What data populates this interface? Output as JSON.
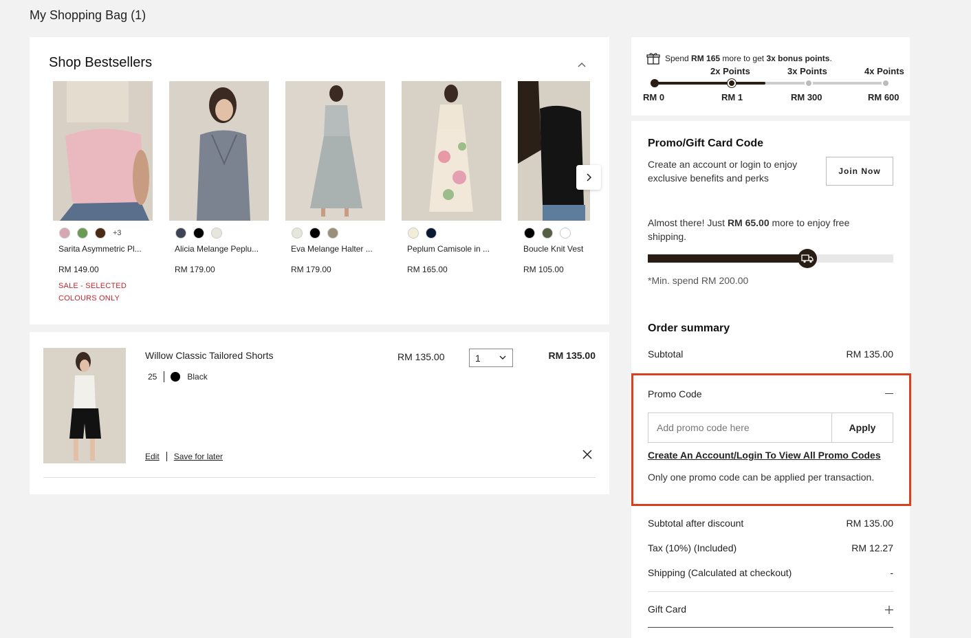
{
  "page": {
    "title": "My Shopping Bag (1)"
  },
  "bestsellers": {
    "title": "Shop Bestsellers",
    "products": [
      {
        "name": "Sarita Asymmetric Pl...",
        "price": "RM 149.00",
        "swatches": [
          "#d6a8b2",
          "#6a9a55",
          "#4a2a12"
        ],
        "more": "+3",
        "sale": [
          "SALE - SELECTED",
          "COLOURS ONLY"
        ]
      },
      {
        "name": "Alicia Melange Peplu...",
        "price": "RM 179.00",
        "swatches": [
          "#3d4354",
          "#000000",
          "#e6e6dc"
        ],
        "more": "",
        "sale": []
      },
      {
        "name": "Eva Melange Halter ...",
        "price": "RM 179.00",
        "swatches": [
          "#e6e6dc",
          "#000000",
          "#9a8f78"
        ],
        "more": "",
        "sale": []
      },
      {
        "name": "Peplum Camisole in ...",
        "price": "RM 165.00",
        "swatches": [
          "#f2edd5",
          "#0b1a33"
        ],
        "more": "",
        "sale": []
      },
      {
        "name": "Boucle Knit Vest",
        "price": "RM 105.00",
        "swatches": [
          "#000000",
          "#556043",
          "#ffffff"
        ],
        "more": "",
        "sale": []
      }
    ]
  },
  "cart": {
    "item_name": "Willow Classic Tailored Shorts",
    "size": "25",
    "color": "Black",
    "unit_price": "RM 135.00",
    "quantity": "1",
    "total": "RM 135.00",
    "edit_label": "Edit",
    "save_label": "Save for later"
  },
  "points": {
    "msg_pre": "Spend ",
    "msg_amount": "RM 165",
    "msg_mid": " more to get ",
    "msg_bonus": "3x bonus points",
    "msg_end": ".",
    "tiers": [
      "2x Points",
      "3x Points",
      "4x Points"
    ],
    "ticks": [
      "RM 0",
      "RM 1",
      "RM 300",
      "RM 600"
    ],
    "progress": 0.48
  },
  "promo_gift": {
    "title": "Promo/Gift Card Code",
    "text1": "Create an account or login to enjoy",
    "text2": "exclusive benefits and perks",
    "join_label": "Join Now"
  },
  "shipping": {
    "msg_pre": "Almost there! Just ",
    "amount": "RM 65.00",
    "msg_post1": " more to enjoy free",
    "msg_post2": "shipping.",
    "min_note": "*Min. spend RM 200.00",
    "progress": 0.65
  },
  "summary": {
    "title": "Order summary",
    "subtotal_label": "Subtotal",
    "subtotal_value": "RM 135.00",
    "promo_label": "Promo Code",
    "promo_placeholder": "Add promo code here",
    "apply_label": "Apply",
    "promo_link": "Create An Account/Login To View All Promo Codes",
    "promo_note": "Only one promo code can be applied per transaction.",
    "after_discount_label": "Subtotal after discount",
    "after_discount_value": "RM 135.00",
    "tax_label": "Tax (10%) (Included)",
    "tax_value": "RM 12.27",
    "shipping_label": "Shipping (Calculated at checkout)",
    "shipping_value": "-",
    "gift_label": "Gift Card"
  }
}
